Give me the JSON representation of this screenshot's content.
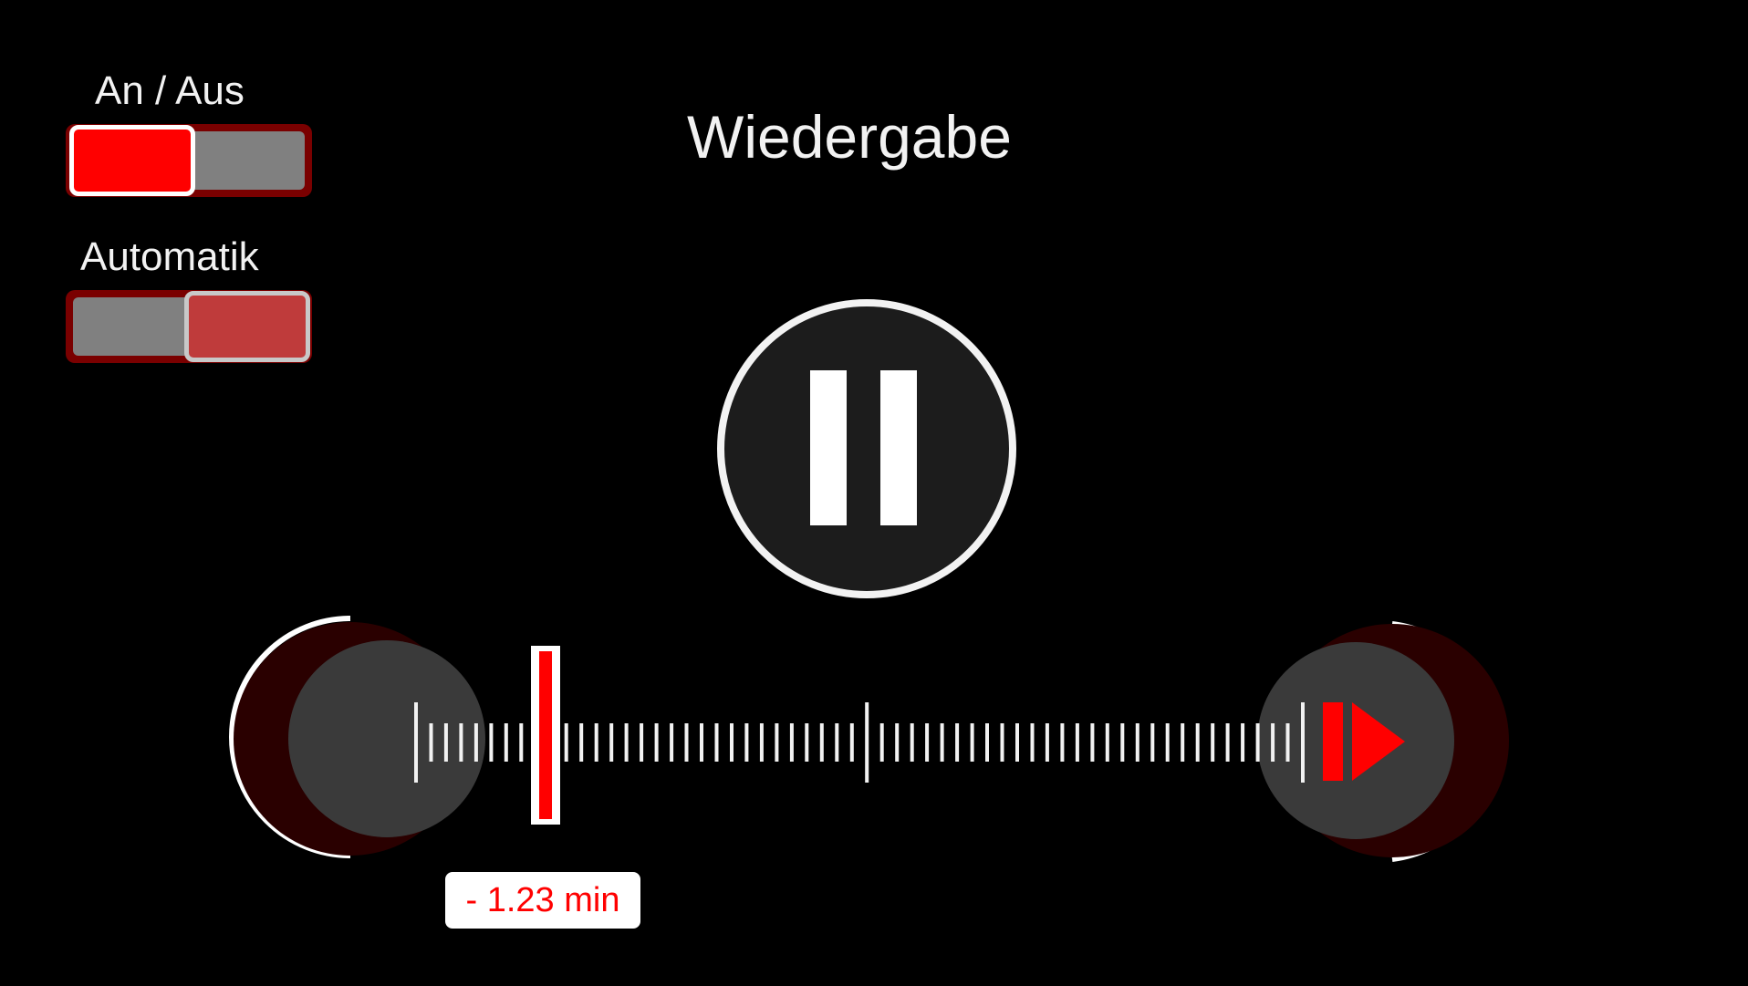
{
  "toggles": {
    "power": {
      "label": "An / Aus",
      "state": "on"
    },
    "automatic": {
      "label": "Automatik",
      "state": "on"
    }
  },
  "title": "Wiedergabe",
  "playback": {
    "main_button_icon": "pause-icon",
    "rewind_button_icon": "rewind-button",
    "forward_button_icon": "skip-forward-icon",
    "remaining_time": "-  1.23 min",
    "position_fraction": 0.15
  },
  "colors": {
    "accent": "#ff0000",
    "dark_red": "#7a0000",
    "button_fill": "#1c1c1c",
    "track_gray": "#808080"
  }
}
